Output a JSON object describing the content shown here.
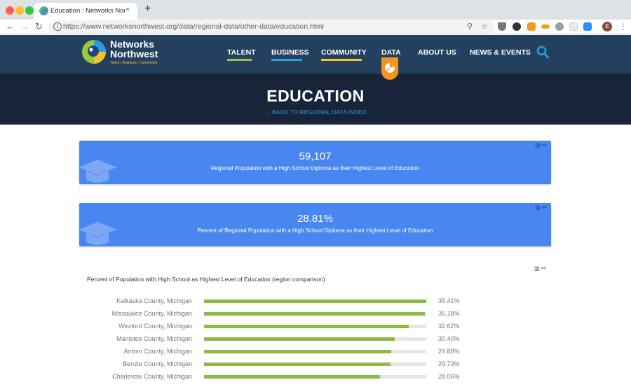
{
  "browser": {
    "tab_title": "Education : Networks Northwest",
    "tab_close": "×",
    "new_tab": "+",
    "url": "https://www.networksnorthwest.org/data/regional-data/other-data/education.html",
    "profile_initial": "E"
  },
  "site": {
    "logo_line1": "Networks",
    "logo_line2": "Northwest",
    "logo_tagline": "Talent / Business / Community",
    "nav": [
      {
        "label": "TALENT",
        "underline": "#9ac93b"
      },
      {
        "label": "BUSINESS",
        "underline": "#2d9be0"
      },
      {
        "label": "COMMUNITY",
        "underline": "#f2c233"
      },
      {
        "label": "DATA",
        "underline": "#f7931e"
      },
      {
        "label": "ABOUT US",
        "underline": ""
      },
      {
        "label": "NEWS & EVENTS",
        "underline": ""
      }
    ],
    "search_icon": "search-icon",
    "accent_color": "#2d9be0"
  },
  "hero": {
    "title": "EDUCATION",
    "back_link": "← BACK TO REGIONAL DATA INDEX"
  },
  "stats": [
    {
      "value": "59,107",
      "label": "Regional Population with a High School Diploma as their Highest Level of Education"
    },
    {
      "value": "28.81%",
      "label": "Percent of Regional Population with a High School Diploma as their Highest Level of Education"
    }
  ],
  "card_tools": "▥ ⚯",
  "chart_tools": "▥ ⚯",
  "chart_data": {
    "type": "bar",
    "orientation": "horizontal",
    "title": "Percent of Population with High School as Highest Level of Education (region comparison)",
    "categories": [
      "Kalkaska County, Michigan",
      "Missaukee County, Michigan",
      "Wexford County, Michigan",
      "Manistee County, Michigan",
      "Antrim County, Michigan",
      "Benzie County, Michigan",
      "Charlevoix County, Michigan"
    ],
    "values": [
      35.41,
      35.18,
      32.62,
      30.4,
      29.88,
      29.73,
      28.06
    ],
    "value_labels": [
      "35.41%",
      "35.18%",
      "32.62%",
      "30.40%",
      "29.88%",
      "29.73%",
      "28.06%"
    ],
    "xlim": [
      0,
      35.41
    ],
    "bar_color": "#8cbb44",
    "track_color": "#e6e6e6"
  }
}
